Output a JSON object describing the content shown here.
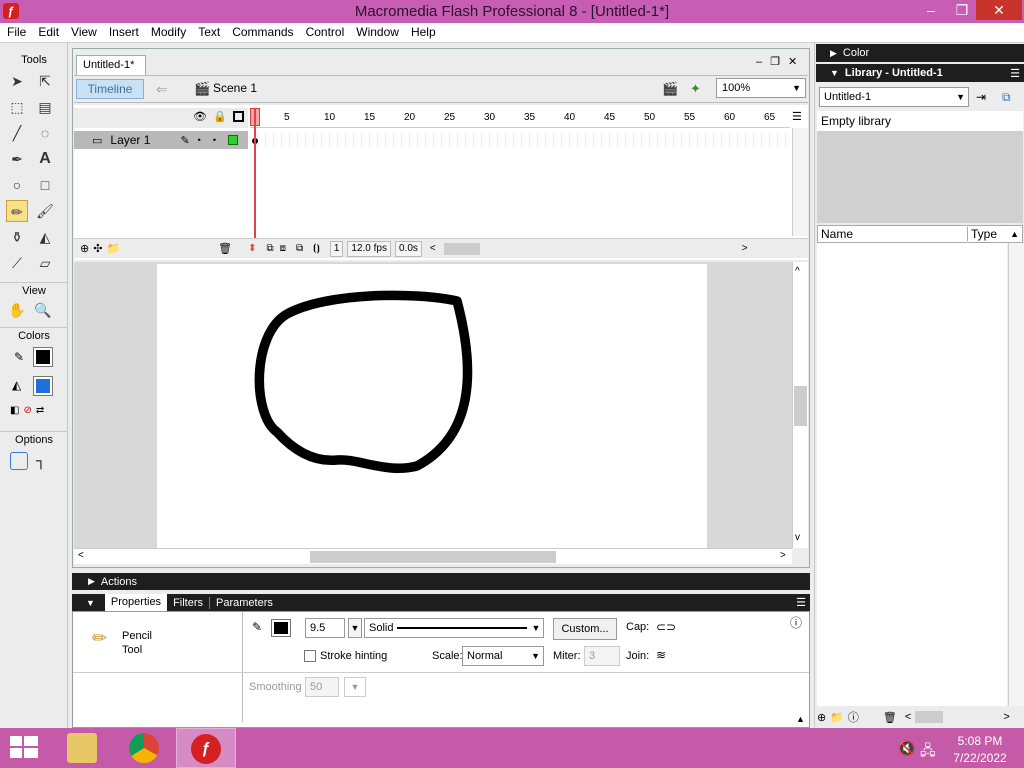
{
  "window": {
    "title": "Macromedia Flash Professional 8 - [Untitled-1*]",
    "app_icon": "ƒ"
  },
  "menu": [
    "File",
    "Edit",
    "View",
    "Insert",
    "Modify",
    "Text",
    "Commands",
    "Control",
    "Window",
    "Help"
  ],
  "tools": {
    "title": "Tools",
    "view_label": "View",
    "colors_label": "Colors",
    "options_label": "Options",
    "stroke_color": "#000000",
    "fill_color": "#1e6fd9"
  },
  "document": {
    "tab": "Untitled-1*",
    "timeline_button": "Timeline",
    "scene": "Scene 1",
    "zoom": "100%"
  },
  "timeline": {
    "layer_name": "Layer 1",
    "ruler": [
      "1",
      "5",
      "10",
      "15",
      "20",
      "25",
      "30",
      "35",
      "40",
      "45",
      "50",
      "55",
      "60",
      "65"
    ],
    "frame": "1",
    "fps": "12.0 fps",
    "time": "0.0s"
  },
  "panels": {
    "actions": "Actions",
    "tabs": [
      "Properties",
      "Filters",
      "Parameters"
    ]
  },
  "properties": {
    "tool_name_1": "Pencil",
    "tool_name_2": "Tool",
    "stroke_height": "9.5",
    "stroke_style": "Solid",
    "custom_button": "Custom...",
    "cap_label": "Cap:",
    "stroke_hinting": "Stroke hinting",
    "scale_label": "Scale:",
    "scale_value": "Normal",
    "miter_label": "Miter:",
    "miter_value": "3",
    "join_label": "Join:",
    "smoothing_label": "Smoothing",
    "smoothing_value": "50",
    "stroke_color": "#000000"
  },
  "color_panel": {
    "title": "Color"
  },
  "library": {
    "title": "Library - Untitled-1",
    "doc": "Untitled-1",
    "empty": "Empty library",
    "col_name": "Name",
    "col_type": "Type"
  },
  "taskbar": {
    "time": "5:08 PM",
    "date": "7/22/2022"
  },
  "colors": {
    "accent": "#c85eb4",
    "taskbar": "#c55aa8",
    "selected_tool": "#f7e08a"
  }
}
